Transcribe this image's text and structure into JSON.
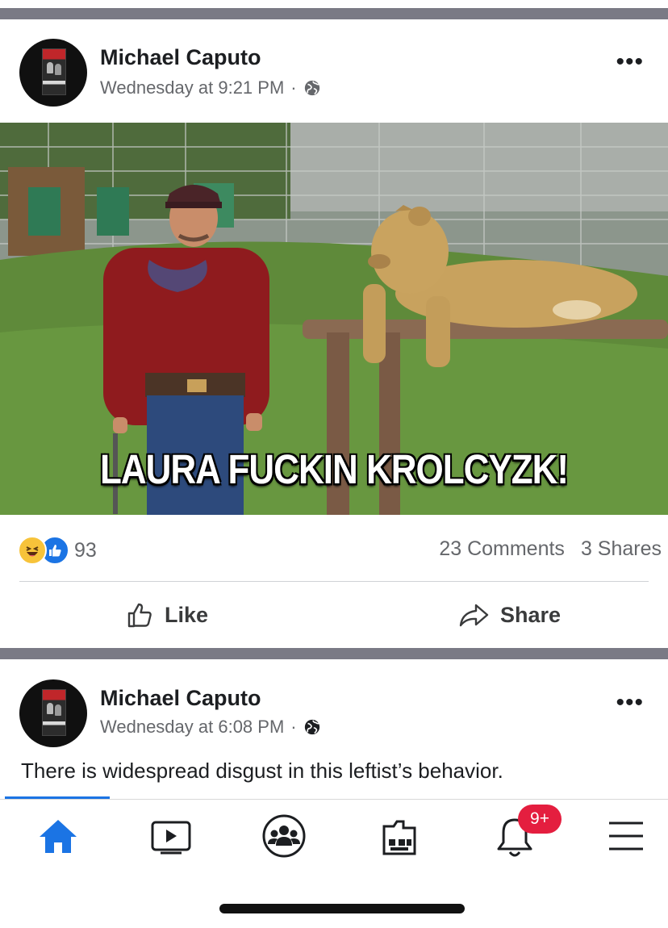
{
  "posts": [
    {
      "author": "Michael Caputo",
      "timestamp": "Wednesday at 9:21 PM",
      "privacy_icon": "globe-icon",
      "image_caption": "LAURA FUCKIN KROLCYZK!",
      "reactions": {
        "types": [
          "haha",
          "like"
        ],
        "count": "93"
      },
      "comments": "23 Comments",
      "shares": "3 Shares",
      "actions": {
        "like": "Like",
        "share": "Share"
      }
    },
    {
      "author": "Michael Caputo",
      "timestamp": "Wednesday at 6:08 PM",
      "privacy_icon": "globe-icon",
      "text": "There is widespread disgust in this leftist’s behavior."
    }
  ],
  "nav": {
    "items": [
      "home-icon",
      "watch-icon",
      "groups-icon",
      "marketplace-icon",
      "notifications-icon",
      "menu-icon"
    ],
    "active": "home-icon",
    "notification_badge": "9+"
  },
  "colors": {
    "accent": "#1b74e4",
    "badge": "#e41e3f",
    "separator": "#7a7a85"
  }
}
